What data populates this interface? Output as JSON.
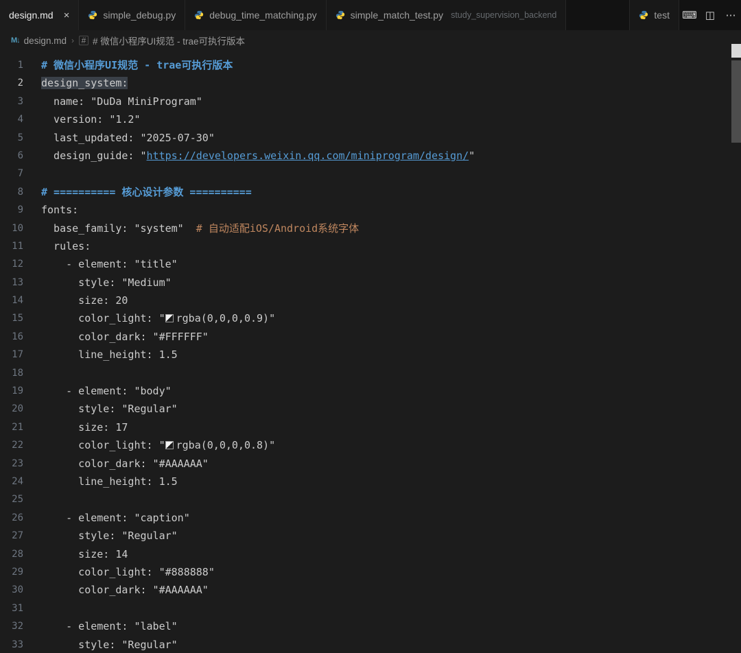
{
  "colors": {
    "editor_background": "#1c1c1c",
    "tabbar_background": "#121212",
    "heading_blue": "#569cd6",
    "comment_orange": "#c0875f",
    "text": "#cccccc",
    "line_highlight": "#3a4048"
  },
  "tab_bar": {
    "tabs": [
      {
        "label": "design.md",
        "active": true,
        "close_glyph": "×"
      },
      {
        "label": "simple_debug.py"
      },
      {
        "label": "debug_time_matching.py"
      },
      {
        "label": "simple_match_test.py",
        "description": "study_supervision_backend"
      }
    ],
    "right_tab": {
      "label": "test"
    },
    "actions": [
      {
        "name": "keyboard",
        "glyph": "⌨"
      },
      {
        "name": "layout",
        "glyph": "◫"
      },
      {
        "name": "more",
        "glyph": "⋯"
      }
    ]
  },
  "breadcrumb": {
    "separator": "›",
    "items": [
      {
        "label": "design.md"
      },
      {
        "label": "# 微信小程序UI规范 - trae可执行版本"
      }
    ],
    "symbol_glyph": "#",
    "markdown_glyph": "M↓"
  },
  "editor": {
    "lines": [
      {
        "n": 1,
        "tokens": [
          {
            "t": "heading",
            "v": "# 微信小程序UI规范 - trae可执行版本"
          }
        ]
      },
      {
        "n": 2,
        "highlight": true,
        "tokens": [
          {
            "t": "text",
            "v": "design_system:"
          }
        ]
      },
      {
        "n": 3,
        "tokens": [
          {
            "t": "text",
            "v": "  name: \"DuDa MiniProgram\""
          }
        ]
      },
      {
        "n": 4,
        "tokens": [
          {
            "t": "text",
            "v": "  version: \"1.2\""
          }
        ]
      },
      {
        "n": 5,
        "tokens": [
          {
            "t": "text",
            "v": "  last_updated: \"2025-07-30\""
          }
        ]
      },
      {
        "n": 6,
        "tokens": [
          {
            "t": "text",
            "v": "  design_guide: \""
          },
          {
            "t": "link",
            "v": "https://developers.weixin.qq.com/miniprogram/design/"
          },
          {
            "t": "text",
            "v": "\""
          }
        ]
      },
      {
        "n": 7,
        "tokens": []
      },
      {
        "n": 8,
        "tokens": [
          {
            "t": "heading",
            "v": "# ========== 核心设计参数 =========="
          }
        ]
      },
      {
        "n": 9,
        "tokens": [
          {
            "t": "text",
            "v": "fonts:"
          }
        ]
      },
      {
        "n": 10,
        "tokens": [
          {
            "t": "text",
            "v": "  base_family: \"system\"  "
          },
          {
            "t": "comment",
            "v": "# 自动适配iOS/Android系统字体"
          }
        ]
      },
      {
        "n": 11,
        "tokens": [
          {
            "t": "text",
            "v": "  rules:"
          }
        ]
      },
      {
        "n": 12,
        "tokens": [
          {
            "t": "text",
            "v": "    - element: \"title\""
          }
        ]
      },
      {
        "n": 13,
        "tokens": [
          {
            "t": "text",
            "v": "      style: \"Medium\""
          }
        ]
      },
      {
        "n": 14,
        "tokens": [
          {
            "t": "text",
            "v": "      size: 20"
          }
        ]
      },
      {
        "n": 15,
        "tokens": [
          {
            "t": "text",
            "v": "      color_light: \""
          },
          {
            "t": "swatch"
          },
          {
            "t": "text",
            "v": "rgba(0,0,0,0.9)\""
          }
        ]
      },
      {
        "n": 16,
        "tokens": [
          {
            "t": "text",
            "v": "      color_dark: \"#FFFFFF\""
          }
        ]
      },
      {
        "n": 17,
        "tokens": [
          {
            "t": "text",
            "v": "      line_height: 1.5"
          }
        ]
      },
      {
        "n": 18,
        "tokens": []
      },
      {
        "n": 19,
        "tokens": [
          {
            "t": "text",
            "v": "    - element: \"body\""
          }
        ]
      },
      {
        "n": 20,
        "tokens": [
          {
            "t": "text",
            "v": "      style: \"Regular\""
          }
        ]
      },
      {
        "n": 21,
        "tokens": [
          {
            "t": "text",
            "v": "      size: 17"
          }
        ]
      },
      {
        "n": 22,
        "tokens": [
          {
            "t": "text",
            "v": "      color_light: \""
          },
          {
            "t": "swatch"
          },
          {
            "t": "text",
            "v": "rgba(0,0,0,0.8)\""
          }
        ]
      },
      {
        "n": 23,
        "tokens": [
          {
            "t": "text",
            "v": "      color_dark: \"#AAAAAA\""
          }
        ]
      },
      {
        "n": 24,
        "tokens": [
          {
            "t": "text",
            "v": "      line_height: 1.5"
          }
        ]
      },
      {
        "n": 25,
        "tokens": []
      },
      {
        "n": 26,
        "tokens": [
          {
            "t": "text",
            "v": "    - element: \"caption\""
          }
        ]
      },
      {
        "n": 27,
        "tokens": [
          {
            "t": "text",
            "v": "      style: \"Regular\""
          }
        ]
      },
      {
        "n": 28,
        "tokens": [
          {
            "t": "text",
            "v": "      size: 14"
          }
        ]
      },
      {
        "n": 29,
        "tokens": [
          {
            "t": "text",
            "v": "      color_light: \"#888888\""
          }
        ]
      },
      {
        "n": 30,
        "tokens": [
          {
            "t": "text",
            "v": "      color_dark: \"#AAAAAA\""
          }
        ]
      },
      {
        "n": 31,
        "tokens": []
      },
      {
        "n": 32,
        "tokens": [
          {
            "t": "text",
            "v": "    - element: \"label\""
          }
        ]
      },
      {
        "n": 33,
        "tokens": [
          {
            "t": "text",
            "v": "      style: \"Regular\""
          }
        ]
      }
    ]
  }
}
